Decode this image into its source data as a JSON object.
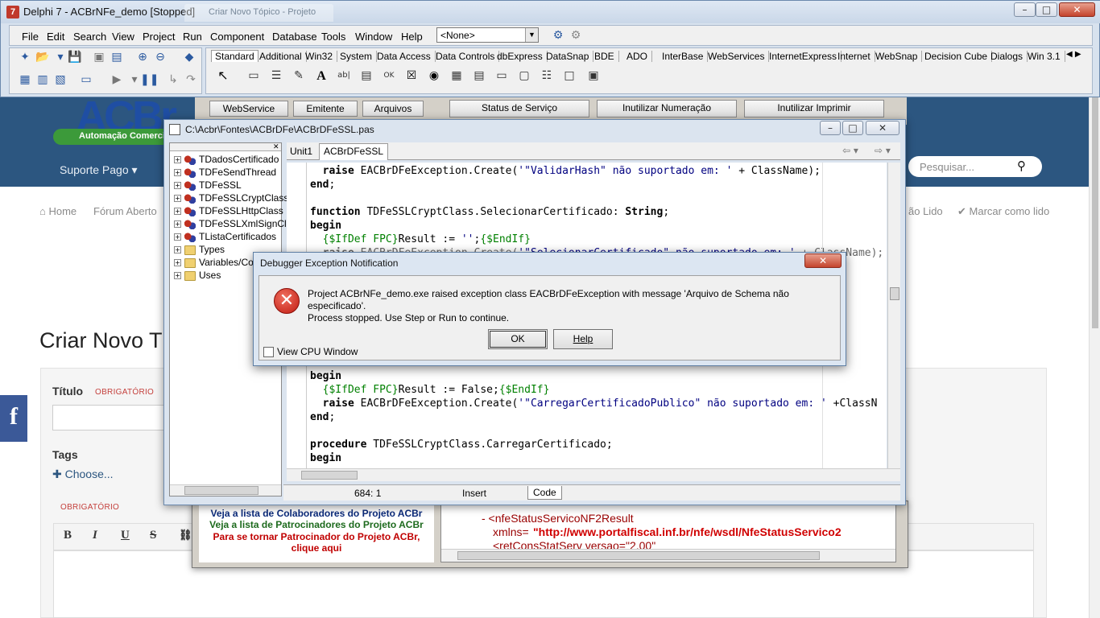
{
  "ide": {
    "title": "Delphi 7 - ACBrNFe_demo [Stopped]",
    "background_tab": "Criar Novo Tópico - Projeto",
    "menu": [
      "File",
      "Edit",
      "Search",
      "View",
      "Project",
      "Run",
      "Component",
      "Database",
      "Tools",
      "Window",
      "Help"
    ],
    "desktop_combo": "<None>",
    "palette_tabs": [
      "Standard",
      "Additional",
      "Win32",
      "System",
      "Data Access",
      "Data Controls",
      "dbExpress",
      "DataSnap",
      "BDE",
      "ADO",
      "InterBase",
      "WebServices",
      "InternetExpress",
      "Internet",
      "WebSnap",
      "Decision Cube",
      "Dialogs",
      "Win 3.1"
    ],
    "active_palette_tab": "Standard"
  },
  "app_behind": {
    "tabs": [
      "WebService",
      "Emitente",
      "Arquivos"
    ],
    "buttons": [
      "Status de Serviço",
      "Inutilizar Numeração",
      "Inutilizar Imprimir"
    ],
    "links": {
      "collaborators": "Veja a lista de Colaboradores do Projeto ACBr",
      "sponsors": "Veja a lista de Patrocinadores do Projeto ACBr",
      "become_sponsor_1": "Para se tornar Patrocinador do Projeto ACBr,",
      "become_sponsor_2": "clique aqui"
    },
    "xml": {
      "line1": "- <nfeStatusServicoNF2Result",
      "line2_attr": "xmlns=",
      "line2_val": "\"http://www.portalfiscal.inf.br/nfe/wsdl/NfeStatusServico2",
      "line3": "<retConsStatServ versao=\"2.00\""
    }
  },
  "forum": {
    "logo_text": "ACBr",
    "logo_tagline": "Automação Comercial",
    "nav_support": "Suporte Pago",
    "search_placeholder": "Pesquisar...",
    "breadcrumb_home": "Home",
    "breadcrumb_forum": "Fórum Aberto",
    "mark_unread": "ão Lido",
    "mark_read": "Marcar como lido",
    "page_title": "Criar Novo T",
    "title_label": "Título",
    "required": "OBRIGATÓRIO",
    "tags_label": "Tags",
    "choose": "Choose...",
    "required_2": "OBRIGATÓRIO",
    "fb": "f"
  },
  "editor": {
    "file_path": "C:\\Acbr\\Fontes\\ACBrDFe\\ACBrDFeSSL.pas",
    "tabs": [
      "Unit1",
      "ACBrDFeSSL"
    ],
    "active_tab": "ACBrDFeSSL",
    "tree": [
      {
        "label": "TDadosCertificado",
        "icon": "class"
      },
      {
        "label": "TDFeSendThread",
        "icon": "class"
      },
      {
        "label": "TDFeSSL",
        "icon": "class"
      },
      {
        "label": "TDFeSSLCryptClass",
        "icon": "class"
      },
      {
        "label": "TDFeSSLHttpClass",
        "icon": "class"
      },
      {
        "label": "TDFeSSLXmlSignCla",
        "icon": "class"
      },
      {
        "label": "TListaCertificados",
        "icon": "class"
      },
      {
        "label": "Types",
        "icon": "folder"
      },
      {
        "label": "Variables/Con",
        "icon": "folder"
      },
      {
        "label": "Uses",
        "icon": "folder"
      }
    ],
    "status": {
      "position": "684:  1",
      "mode": "Insert",
      "view": "Code"
    }
  },
  "dialog": {
    "title": "Debugger Exception Notification",
    "message_line1": "Project ACBrNFe_demo.exe raised exception class EACBrDFeException with message 'Arquivo de Schema não especificado'.",
    "message_line2": "Process stopped. Use Step or Run to continue.",
    "ok": "OK",
    "help": "Help",
    "view_cpu": "View CPU Window"
  },
  "colors": {
    "accent": "#2c5680",
    "error": "#c01a10",
    "ide_frame": "#dbe4ef"
  }
}
